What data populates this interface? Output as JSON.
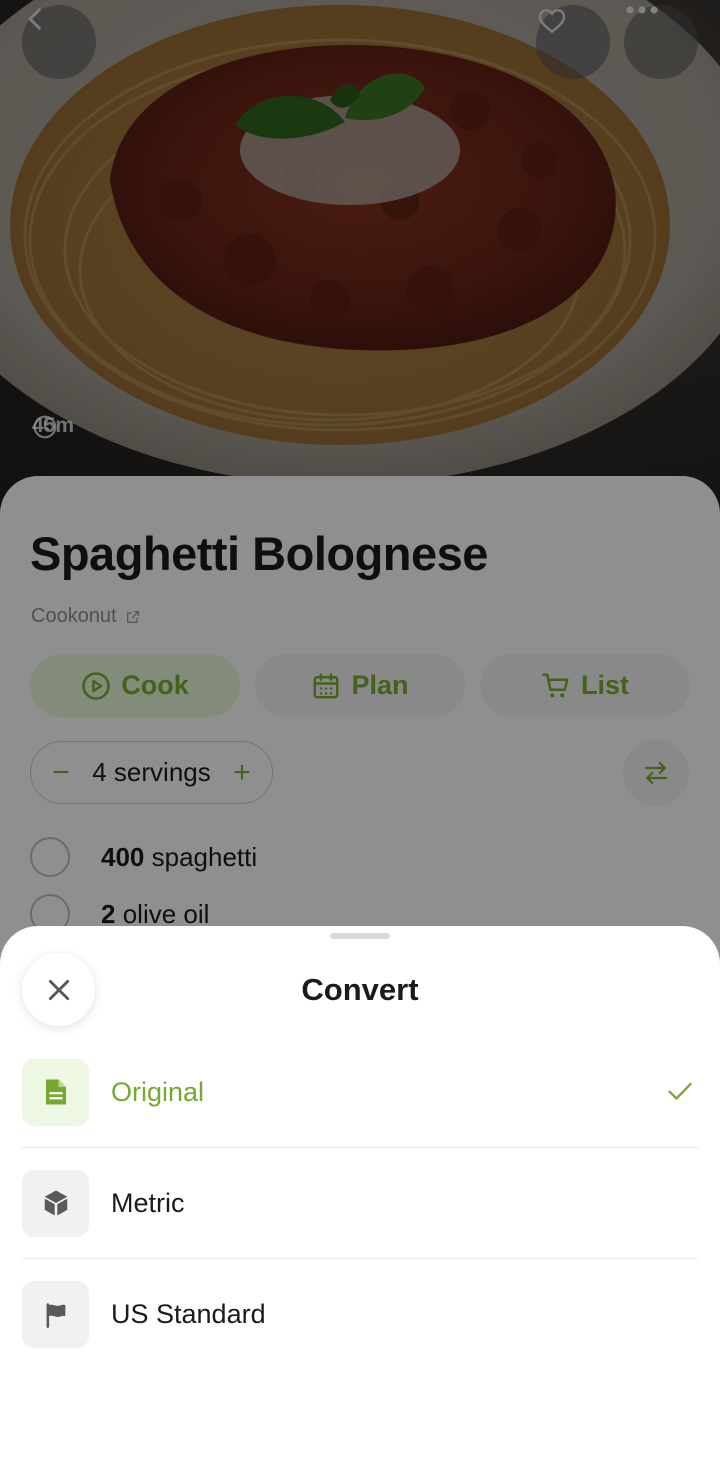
{
  "hero": {
    "time": "45m",
    "image_description_icon": "spaghetti-photo"
  },
  "recipe": {
    "title": "Spaghetti Bolognese",
    "source": "Cookonut",
    "actions": {
      "cook": "Cook",
      "plan": "Plan",
      "list": "List"
    },
    "servings": "4 servings",
    "ingredients": [
      {
        "qty": "400",
        "name": "spaghetti"
      },
      {
        "qty": "2",
        "name": "olive oil"
      }
    ]
  },
  "sheet": {
    "title": "Convert",
    "options": [
      {
        "label": "Original",
        "icon": "document-icon",
        "selected": true
      },
      {
        "label": "Metric",
        "icon": "cube-icon",
        "selected": false
      },
      {
        "label": "US Standard",
        "icon": "flag-icon",
        "selected": false
      }
    ]
  },
  "colors": {
    "accent": "#76a832",
    "accent_bg": "#e2f0d4",
    "scrim": "rgba(0,0,0,0.42)"
  }
}
